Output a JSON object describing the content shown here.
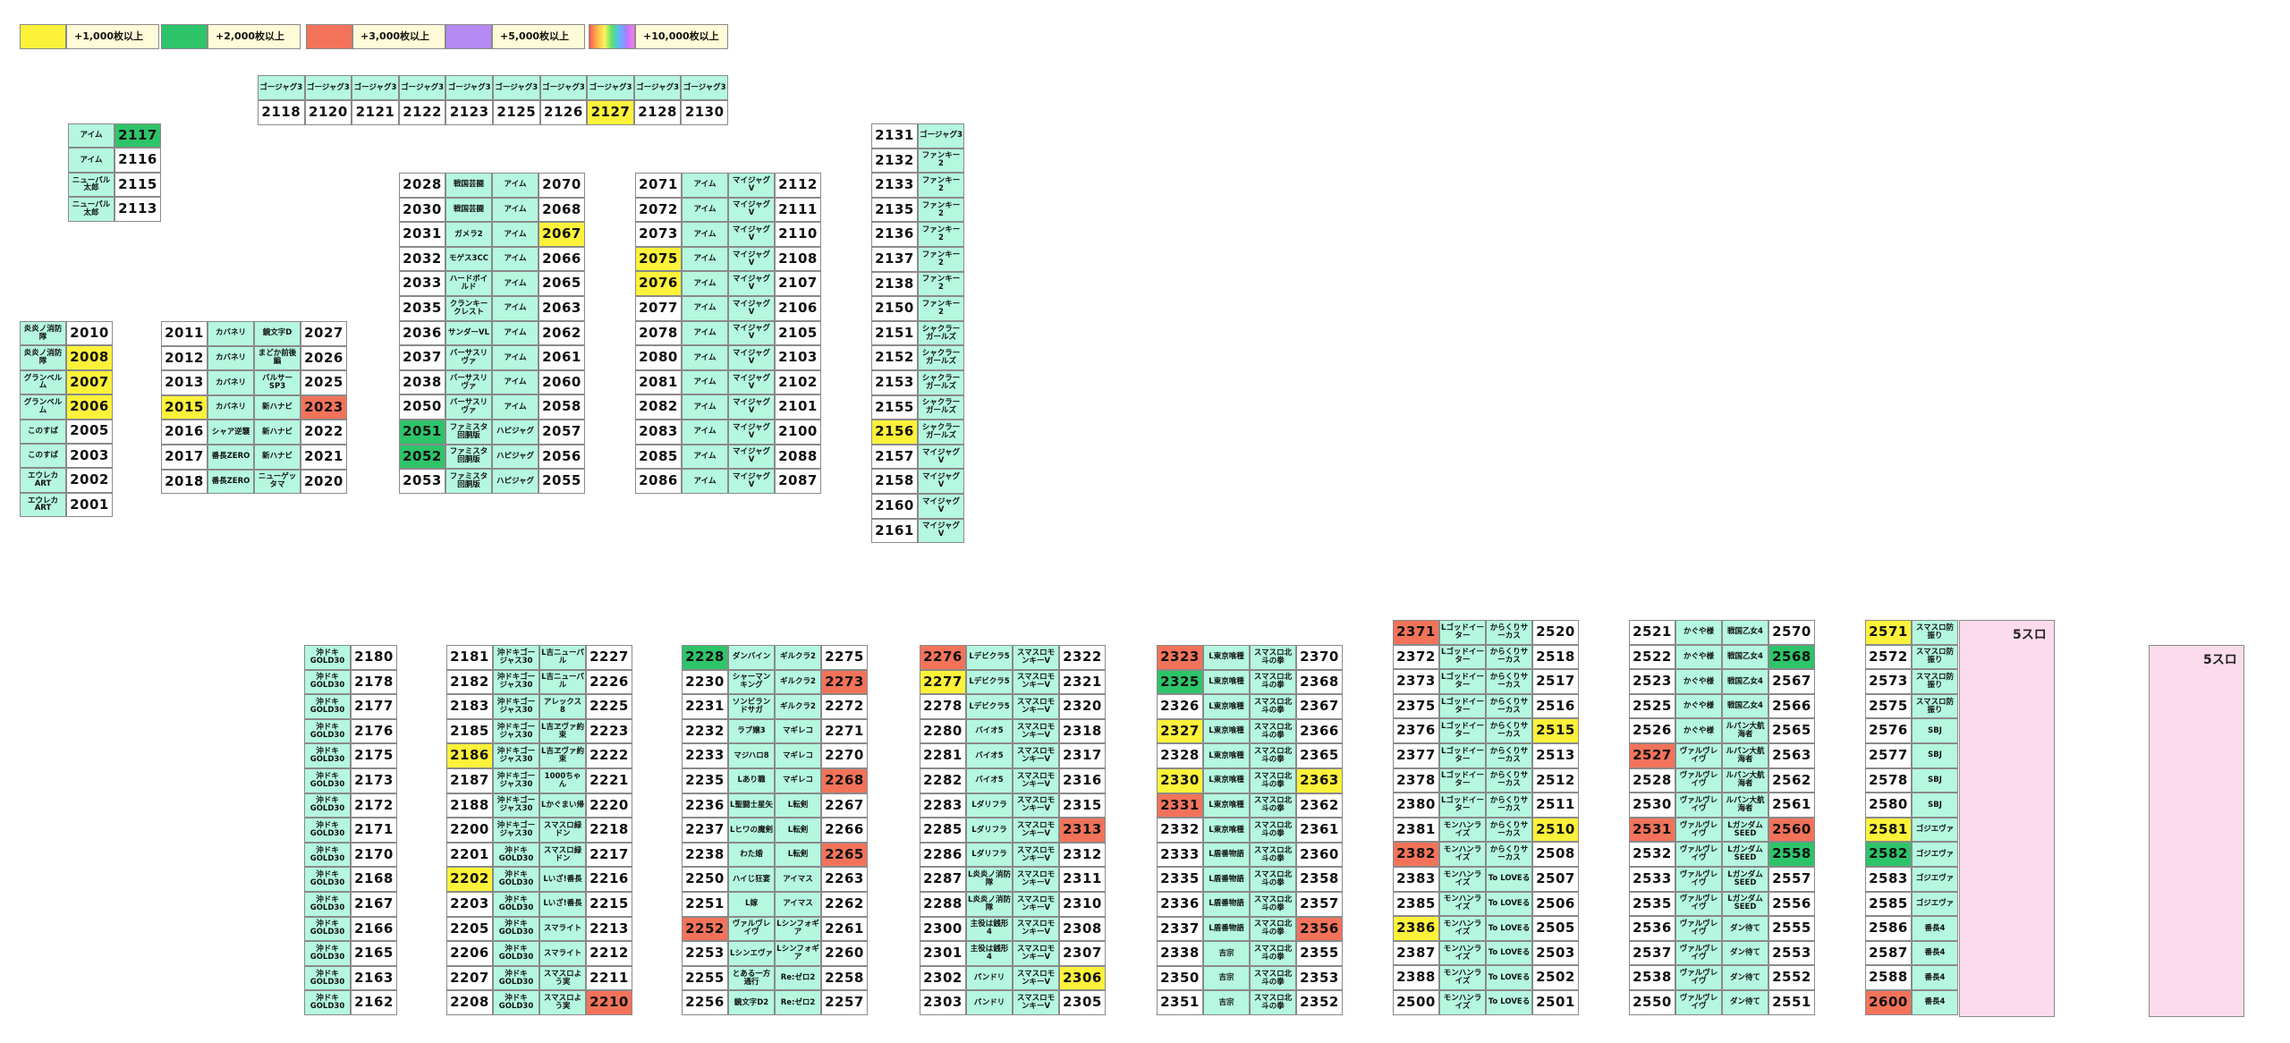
{
  "colors": {
    "yellow": "#fdf23a",
    "green": "#2ec46a",
    "red": "#f2735a",
    "purple": "#b58af2",
    "machine_bg": "#b5f7df",
    "label_bg": "#fffbd8",
    "pink_block": "#fcdcec"
  },
  "legend": [
    {
      "color": "yellow",
      "label": "+1,000枚以上"
    },
    {
      "color": "green",
      "label": "+2,000枚以上"
    },
    {
      "color": "red",
      "label": "+3,000枚以上"
    },
    {
      "color": "purple",
      "label": "+5,000枚以上"
    },
    {
      "color": "rainbow",
      "label": "+10,000枚以上"
    }
  ],
  "blocks": {
    "top_row": {
      "names": [
        "ゴージャグ3",
        "ゴージャグ3",
        "ゴージャグ3",
        "ゴージャグ3",
        "ゴージャグ3",
        "ゴージャグ3",
        "ゴージャグ3",
        "ゴージャグ3",
        "ゴージャグ3",
        "ゴージャグ3"
      ],
      "numbers": [
        "2118",
        "2120",
        "2121",
        "2122",
        "2123",
        "2125",
        "2126",
        "2127",
        "2128",
        "2130"
      ],
      "hl": [
        "",
        "",
        "",
        "",
        "",
        "",
        "",
        "yellow",
        "",
        ""
      ]
    },
    "block_a": [
      [
        "アイム",
        "2117",
        "green"
      ],
      [
        "アイム",
        "2116",
        ""
      ],
      [
        "ニューパル太郎",
        "2115",
        ""
      ],
      [
        "ニューパル太郎",
        "2113",
        ""
      ]
    ],
    "block_b": [
      [
        "炎炎ノ消防隊",
        "2010",
        ""
      ],
      [
        "炎炎ノ消防隊",
        "2008",
        "yellow"
      ],
      [
        "グランベルム",
        "2007",
        "yellow"
      ],
      [
        "グランベルム",
        "2006",
        "yellow"
      ],
      [
        "このすば",
        "2005",
        ""
      ],
      [
        "このすば",
        "2003",
        ""
      ],
      [
        "エウレカART",
        "2002",
        ""
      ],
      [
        "エウレカART",
        "2001",
        ""
      ]
    ],
    "block_c": [
      [
        "2011",
        "",
        "カバネリ",
        "鏡文字D",
        "2027",
        ""
      ],
      [
        "2012",
        "",
        "カバネリ",
        "まどか前後編",
        "2026",
        ""
      ],
      [
        "2013",
        "",
        "カバネリ",
        "バルサーSP3",
        "2025",
        ""
      ],
      [
        "2015",
        "yellow",
        "カバネリ",
        "新ハナビ",
        "2023",
        "red"
      ],
      [
        "2016",
        "",
        "シャア逆襲",
        "新ハナビ",
        "2022",
        ""
      ],
      [
        "2017",
        "",
        "番長ZERO",
        "新ハナビ",
        "2021",
        ""
      ],
      [
        "2018",
        "",
        "番長ZERO",
        "ニューゲッタマ",
        "2020",
        ""
      ]
    ],
    "block_d": [
      [
        "2028",
        "",
        "戦国芸闘",
        "アイム",
        "2070",
        ""
      ],
      [
        "2030",
        "",
        "戦国芸闘",
        "アイム",
        "2068",
        ""
      ],
      [
        "2031",
        "",
        "ガメラ2",
        "アイム",
        "2067",
        "yellow"
      ],
      [
        "2032",
        "",
        "モゲス3CC",
        "アイム",
        "2066",
        ""
      ],
      [
        "2033",
        "",
        "ハードボイルド",
        "アイム",
        "2065",
        ""
      ],
      [
        "2035",
        "",
        "クランキークレスト",
        "アイム",
        "2063",
        ""
      ],
      [
        "2036",
        "",
        "サンダーVL",
        "アイム",
        "2062",
        ""
      ],
      [
        "2037",
        "",
        "バーサスリヴァ",
        "アイム",
        "2061",
        ""
      ],
      [
        "2038",
        "",
        "バーサスリヴァ",
        "アイム",
        "2060",
        ""
      ],
      [
        "2050",
        "",
        "バーサスリヴァ",
        "アイム",
        "2058",
        ""
      ],
      [
        "2051",
        "green",
        "ファミスタ回胴版",
        "ハピジャグ",
        "2057",
        ""
      ],
      [
        "2052",
        "green",
        "ファミスタ回胴版",
        "ハピジャグ",
        "2056",
        ""
      ],
      [
        "2053",
        "",
        "ファミスタ回胴版",
        "ハピジャグ",
        "2055",
        ""
      ]
    ],
    "block_e": [
      [
        "2071",
        "",
        "アイム",
        "マイジャグV",
        "2112",
        ""
      ],
      [
        "2072",
        "",
        "アイム",
        "マイジャグV",
        "2111",
        ""
      ],
      [
        "2073",
        "",
        "アイム",
        "マイジャグV",
        "2110",
        ""
      ],
      [
        "2075",
        "yellow",
        "アイム",
        "マイジャグV",
        "2108",
        ""
      ],
      [
        "2076",
        "yellow",
        "アイム",
        "マイジャグV",
        "2107",
        ""
      ],
      [
        "2077",
        "",
        "アイム",
        "マイジャグV",
        "2106",
        ""
      ],
      [
        "2078",
        "",
        "アイム",
        "マイジャグV",
        "2105",
        ""
      ],
      [
        "2080",
        "",
        "アイム",
        "マイジャグV",
        "2103",
        ""
      ],
      [
        "2081",
        "",
        "アイム",
        "マイジャグV",
        "2102",
        ""
      ],
      [
        "2082",
        "",
        "アイム",
        "マイジャグV",
        "2101",
        ""
      ],
      [
        "2083",
        "",
        "アイム",
        "マイジャグV",
        "2100",
        ""
      ],
      [
        "2085",
        "",
        "アイム",
        "マイジャグV",
        "2088",
        ""
      ],
      [
        "2086",
        "",
        "アイム",
        "マイジャグV",
        "2087",
        ""
      ]
    ],
    "block_f": [
      [
        "2131",
        "",
        "ゴージャグ3"
      ],
      [
        "2132",
        "",
        "ファンキー2"
      ],
      [
        "2133",
        "",
        "ファンキー2"
      ],
      [
        "2135",
        "",
        "ファンキー2"
      ],
      [
        "2136",
        "",
        "ファンキー2"
      ],
      [
        "2137",
        "",
        "ファンキー2"
      ],
      [
        "2138",
        "",
        "ファンキー2"
      ],
      [
        "2150",
        "",
        "ファンキー2"
      ],
      [
        "2151",
        "",
        "シャクラーガールズ"
      ],
      [
        "2152",
        "",
        "シャクラーガールズ"
      ],
      [
        "2153",
        "",
        "シャクラーガールズ"
      ],
      [
        "2155",
        "",
        "シャクラーガールズ"
      ],
      [
        "2156",
        "yellow",
        "シャクラーガールズ"
      ],
      [
        "2157",
        "",
        "マイジャグV"
      ],
      [
        "2158",
        "",
        "マイジャグV"
      ],
      [
        "2160",
        "",
        "マイジャグV"
      ],
      [
        "2161",
        "",
        "マイジャグV"
      ]
    ],
    "block_g": [
      [
        "沖ドキGOLD30",
        "2180",
        ""
      ],
      [
        "沖ドキGOLD30",
        "2178",
        ""
      ],
      [
        "沖ドキGOLD30",
        "2177",
        ""
      ],
      [
        "沖ドキGOLD30",
        "2176",
        ""
      ],
      [
        "沖ドキGOLD30",
        "2175",
        ""
      ],
      [
        "沖ドキGOLD30",
        "2173",
        ""
      ],
      [
        "沖ドキGOLD30",
        "2172",
        ""
      ],
      [
        "沖ドキGOLD30",
        "2171",
        ""
      ],
      [
        "沖ドキGOLD30",
        "2170",
        ""
      ],
      [
        "沖ドキGOLD30",
        "2168",
        ""
      ],
      [
        "沖ドキGOLD30",
        "2167",
        ""
      ],
      [
        "沖ドキGOLD30",
        "2166",
        ""
      ],
      [
        "沖ドキGOLD30",
        "2165",
        ""
      ],
      [
        "沖ドキGOLD30",
        "2163",
        ""
      ],
      [
        "沖ドキGOLD30",
        "2162",
        ""
      ]
    ],
    "block_h": [
      [
        "2181",
        "",
        "沖ドキゴージャス30",
        "L吉ニューパル",
        "2227",
        ""
      ],
      [
        "2182",
        "",
        "沖ドキゴージャス30",
        "L吉ニューパル",
        "2226",
        ""
      ],
      [
        "2183",
        "",
        "沖ドキゴージャス30",
        "アレックス8",
        "2225",
        ""
      ],
      [
        "2185",
        "",
        "沖ドキゴージャス30",
        "L吉ヱヴァ約束",
        "2223",
        ""
      ],
      [
        "2186",
        "yellow",
        "沖ドキゴージャス30",
        "L吉ヱヴァ約束",
        "2222",
        ""
      ],
      [
        "2187",
        "",
        "沖ドキゴージャス30",
        "1000ちゃん",
        "2221",
        ""
      ],
      [
        "2188",
        "",
        "沖ドキゴージャス30",
        "Lかぐまい帰",
        "2220",
        ""
      ],
      [
        "2200",
        "",
        "沖ドキゴージャス30",
        "スマスロ緑ドン",
        "2218",
        ""
      ],
      [
        "2201",
        "",
        "沖ドキGOLD30",
        "スマスロ緑ドン",
        "2217",
        ""
      ],
      [
        "2202",
        "yellow",
        "沖ドキGOLD30",
        "Lいざ!番長",
        "2216",
        ""
      ],
      [
        "2203",
        "",
        "沖ドキGOLD30",
        "Lいざ!番長",
        "2215",
        ""
      ],
      [
        "2205",
        "",
        "沖ドキGOLD30",
        "スマライト",
        "2213",
        ""
      ],
      [
        "2206",
        "",
        "沖ドキGOLD30",
        "スマライト",
        "2212",
        ""
      ],
      [
        "2207",
        "",
        "沖ドキGOLD30",
        "スマスロよう実",
        "2211",
        ""
      ],
      [
        "2208",
        "",
        "沖ドキGOLD30",
        "スマスロよう実",
        "2210",
        "red"
      ]
    ],
    "block_i": [
      [
        "2228",
        "green",
        "ダンバイン",
        "ギルクラ2",
        "2275",
        ""
      ],
      [
        "2230",
        "",
        "シャーマンキング",
        "ギルクラ2",
        "2273",
        "red"
      ],
      [
        "2231",
        "",
        "ソンビランドサガ",
        "ギルクラ2",
        "2272",
        ""
      ],
      [
        "2232",
        "",
        "ラブ嬢3",
        "マギレコ",
        "2271",
        ""
      ],
      [
        "2233",
        "",
        "マジハロ8",
        "マギレコ",
        "2270",
        ""
      ],
      [
        "2235",
        "",
        "Lあり職",
        "マギレコ",
        "2268",
        "red"
      ],
      [
        "2236",
        "",
        "L聖闘士星矢",
        "L転剣",
        "2267",
        ""
      ],
      [
        "2237",
        "",
        "Lヒワの魔剣",
        "L転剣",
        "2266",
        ""
      ],
      [
        "2238",
        "",
        "わた婚",
        "L転剣",
        "2265",
        "red"
      ],
      [
        "2250",
        "",
        "ハイじ狂宴",
        "アイマス",
        "2263",
        ""
      ],
      [
        "2251",
        "",
        "L嫁",
        "アイマス",
        "2262",
        ""
      ],
      [
        "2252",
        "red",
        "ヴァルヴレイヴ",
        "Lシンフォギア",
        "2261",
        ""
      ],
      [
        "2253",
        "",
        "Lシンエヴァ",
        "Lシンフォギア",
        "2260",
        ""
      ],
      [
        "2255",
        "",
        "とある一方通行",
        "Re:ゼロ2",
        "2258",
        ""
      ],
      [
        "2256",
        "",
        "鏡文字D2",
        "Re:ゼロ2",
        "2257",
        ""
      ]
    ],
    "block_j": [
      [
        "2276",
        "red",
        "Lデビクラ5",
        "スマスロモンキーV",
        "2322",
        ""
      ],
      [
        "2277",
        "yellow",
        "Lデビクラ5",
        "スマスロモンキーV",
        "2321",
        ""
      ],
      [
        "2278",
        "",
        "Lデビクラ5",
        "スマスロモンキーV",
        "2320",
        ""
      ],
      [
        "2280",
        "",
        "バイオ5",
        "スマスロモンキーV",
        "2318",
        ""
      ],
      [
        "2281",
        "",
        "バイオ5",
        "スマスロモンキーV",
        "2317",
        ""
      ],
      [
        "2282",
        "",
        "バイオ5",
        "スマスロモンキーV",
        "2316",
        ""
      ],
      [
        "2283",
        "",
        "Lダリフラ",
        "スマスロモンキーV",
        "2315",
        ""
      ],
      [
        "2285",
        "",
        "Lダリフラ",
        "スマスロモンキーV",
        "2313",
        "red"
      ],
      [
        "2286",
        "",
        "Lダリフラ",
        "スマスロモンキーV",
        "2312",
        ""
      ],
      [
        "2287",
        "",
        "L炎炎ノ消防隊",
        "スマスロモンキーV",
        "2311",
        ""
      ],
      [
        "2288",
        "",
        "L炎炎ノ消防隊",
        "スマスロモンキーV",
        "2310",
        ""
      ],
      [
        "2300",
        "",
        "主役は銭形4",
        "スマスロモンキーV",
        "2308",
        ""
      ],
      [
        "2301",
        "",
        "主役は銭形4",
        "スマスロモンキーV",
        "2307",
        ""
      ],
      [
        "2302",
        "",
        "パンドリ",
        "スマスロモンキーV",
        "2306",
        "yellow"
      ],
      [
        "2303",
        "",
        "パンドリ",
        "スマスロモンキーV",
        "2305",
        ""
      ]
    ],
    "block_k": [
      [
        "2323",
        "red",
        "L東京喰種",
        "スマスロ北斗の拳",
        "2370",
        ""
      ],
      [
        "2325",
        "green",
        "L東京喰種",
        "スマスロ北斗の拳",
        "2368",
        ""
      ],
      [
        "2326",
        "",
        "L東京喰種",
        "スマスロ北斗の拳",
        "2367",
        ""
      ],
      [
        "2327",
        "yellow",
        "L東京喰種",
        "スマスロ北斗の拳",
        "2366",
        ""
      ],
      [
        "2328",
        "",
        "L東京喰種",
        "スマスロ北斗の拳",
        "2365",
        ""
      ],
      [
        "2330",
        "yellow",
        "L東京喰種",
        "スマスロ北斗の拳",
        "2363",
        "yellow"
      ],
      [
        "2331",
        "red",
        "L東京喰種",
        "スマスロ北斗の拳",
        "2362",
        ""
      ],
      [
        "2332",
        "",
        "L東京喰種",
        "スマスロ北斗の拳",
        "2361",
        ""
      ],
      [
        "2333",
        "",
        "L盾番物語",
        "スマスロ北斗の拳",
        "2360",
        ""
      ],
      [
        "2335",
        "",
        "L盾番物語",
        "スマスロ北斗の拳",
        "2358",
        ""
      ],
      [
        "2336",
        "",
        "L盾番物語",
        "スマスロ北斗の拳",
        "2357",
        ""
      ],
      [
        "2337",
        "",
        "L盾番物語",
        "スマスロ北斗の拳",
        "2356",
        "red"
      ],
      [
        "2338",
        "",
        "吉宗",
        "スマスロ北斗の拳",
        "2355",
        ""
      ],
      [
        "2350",
        "",
        "吉宗",
        "スマスロ北斗の拳",
        "2353",
        ""
      ],
      [
        "2351",
        "",
        "吉宗",
        "スマスロ北斗の拳",
        "2352",
        ""
      ]
    ],
    "block_l": [
      [
        "2371",
        "red",
        "Lゴッドイーター",
        "からくりサーカス",
        "2520",
        ""
      ],
      [
        "2372",
        "",
        "Lゴッドイーター",
        "からくりサーカス",
        "2518",
        ""
      ],
      [
        "2373",
        "",
        "Lゴッドイーター",
        "からくりサーカス",
        "2517",
        ""
      ],
      [
        "2375",
        "",
        "Lゴッドイーター",
        "からくりサーカス",
        "2516",
        ""
      ],
      [
        "2376",
        "",
        "Lゴッドイーター",
        "からくりサーカス",
        "2515",
        "yellow"
      ],
      [
        "2377",
        "",
        "Lゴッドイーター",
        "からくりサーカス",
        "2513",
        ""
      ],
      [
        "2378",
        "",
        "Lゴッドイーター",
        "からくりサーカス",
        "2512",
        ""
      ],
      [
        "2380",
        "",
        "Lゴッドイーター",
        "からくりサーカス",
        "2511",
        ""
      ],
      [
        "2381",
        "",
        "モンハンライズ",
        "からくりサーカス",
        "2510",
        "yellow"
      ],
      [
        "2382",
        "red",
        "モンハンライズ",
        "からくりサーカス",
        "2508",
        ""
      ],
      [
        "2383",
        "",
        "モンハンライズ",
        "To LOVEる",
        "2507",
        ""
      ],
      [
        "2385",
        "",
        "モンハンライズ",
        "To LOVEる",
        "2506",
        ""
      ],
      [
        "2386",
        "yellow",
        "モンハンライズ",
        "To LOVEる",
        "2505",
        ""
      ],
      [
        "2387",
        "",
        "モンハンライズ",
        "To LOVEる",
        "2503",
        ""
      ],
      [
        "2388",
        "",
        "モンハンライズ",
        "To LOVEる",
        "2502",
        ""
      ],
      [
        "2500",
        "",
        "モンハンライズ",
        "To LOVEる",
        "2501",
        ""
      ]
    ],
    "block_m": [
      [
        "2521",
        "",
        "かぐや様",
        "戦国乙女4",
        "2570",
        ""
      ],
      [
        "2522",
        "",
        "かぐや様",
        "戦国乙女4",
        "2568",
        "green"
      ],
      [
        "2523",
        "",
        "かぐや様",
        "戦国乙女4",
        "2567",
        ""
      ],
      [
        "2525",
        "",
        "かぐや様",
        "戦国乙女4",
        "2566",
        ""
      ],
      [
        "2526",
        "",
        "かぐや様",
        "ルパン大航海者",
        "2565",
        ""
      ],
      [
        "2527",
        "red",
        "ヴァルヴレイヴ",
        "ルパン大航海者",
        "2563",
        ""
      ],
      [
        "2528",
        "",
        "ヴァルヴレイヴ",
        "ルパン大航海者",
        "2562",
        ""
      ],
      [
        "2530",
        "",
        "ヴァルヴレイヴ",
        "ルパン大航海者",
        "2561",
        ""
      ],
      [
        "2531",
        "red",
        "ヴァルヴレイヴ",
        "LガンダムSEED",
        "2560",
        "red"
      ],
      [
        "2532",
        "",
        "ヴァルヴレイヴ",
        "LガンダムSEED",
        "2558",
        "green"
      ],
      [
        "2533",
        "",
        "ヴァルヴレイヴ",
        "LガンダムSEED",
        "2557",
        ""
      ],
      [
        "2535",
        "",
        "ヴァルヴレイヴ",
        "LガンダムSEED",
        "2556",
        ""
      ],
      [
        "2536",
        "",
        "ヴァルヴレイヴ",
        "ダン待て",
        "2555",
        ""
      ],
      [
        "2537",
        "",
        "ヴァルヴレイヴ",
        "ダン待て",
        "2553",
        ""
      ],
      [
        "2538",
        "",
        "ヴァルヴレイヴ",
        "ダン待て",
        "2552",
        ""
      ],
      [
        "2550",
        "",
        "ヴァルヴレイヴ",
        "ダン待て",
        "2551",
        ""
      ]
    ],
    "block_n": [
      [
        "2571",
        "yellow",
        "スマスロ防振り"
      ],
      [
        "2572",
        "",
        "スマスロ防振り"
      ],
      [
        "2573",
        "",
        "スマスロ防振り"
      ],
      [
        "2575",
        "",
        "スマスロ防振り"
      ],
      [
        "2576",
        "",
        "SBJ"
      ],
      [
        "2577",
        "",
        "SBJ"
      ],
      [
        "2578",
        "",
        "SBJ"
      ],
      [
        "2580",
        "",
        "SBJ"
      ],
      [
        "2581",
        "yellow",
        "ゴジエヴァ"
      ],
      [
        "2582",
        "green",
        "ゴジエヴァ"
      ],
      [
        "2583",
        "",
        "ゴジエヴァ"
      ],
      [
        "2585",
        "",
        "ゴジエヴァ"
      ],
      [
        "2586",
        "",
        "番長4"
      ],
      [
        "2587",
        "",
        "番長4"
      ],
      [
        "2588",
        "",
        "番長4"
      ],
      [
        "2600",
        "red",
        "番長4"
      ]
    ],
    "pink_label_1": "5スロ",
    "pink_label_2": "5スロ"
  }
}
